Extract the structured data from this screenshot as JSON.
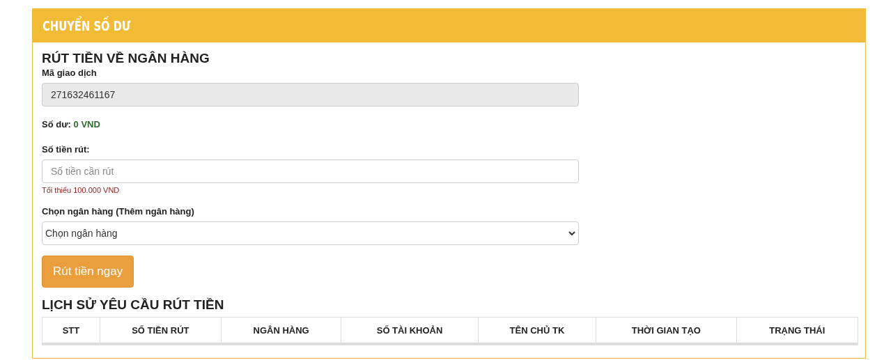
{
  "panel": {
    "title": "CHUYỂN SỐ DƯ"
  },
  "form": {
    "title": "RÚT TIỀN VỀ NGÂN HÀNG",
    "transaction_id": {
      "label": "Mã giao dịch",
      "value": "271632461167",
      "disabled": true
    },
    "balance": {
      "label": "Số dư:",
      "value": "0 VND"
    },
    "amount": {
      "label": "Số tiền rút:",
      "placeholder": "Số tiền cần rút",
      "hint": "Tối thiểu 100.000 VND"
    },
    "bank": {
      "label": "Chọn ngân hàng (Thêm ngân hàng)",
      "value": "Chọn ngân hàng"
    },
    "submit": "Rút tiền ngay"
  },
  "history": {
    "title": "LỊCH SỬ YÊU CẦU RÚT TIỀN",
    "columns": [
      "STT",
      "SỐ TIỀN RÚT",
      "NGÂN HÀNG",
      "SỐ TÀI KHOẢN",
      "TÊN CHỦ TK",
      "THỜI GIAN TẠO",
      "TRẠNG THÁI"
    ]
  }
}
